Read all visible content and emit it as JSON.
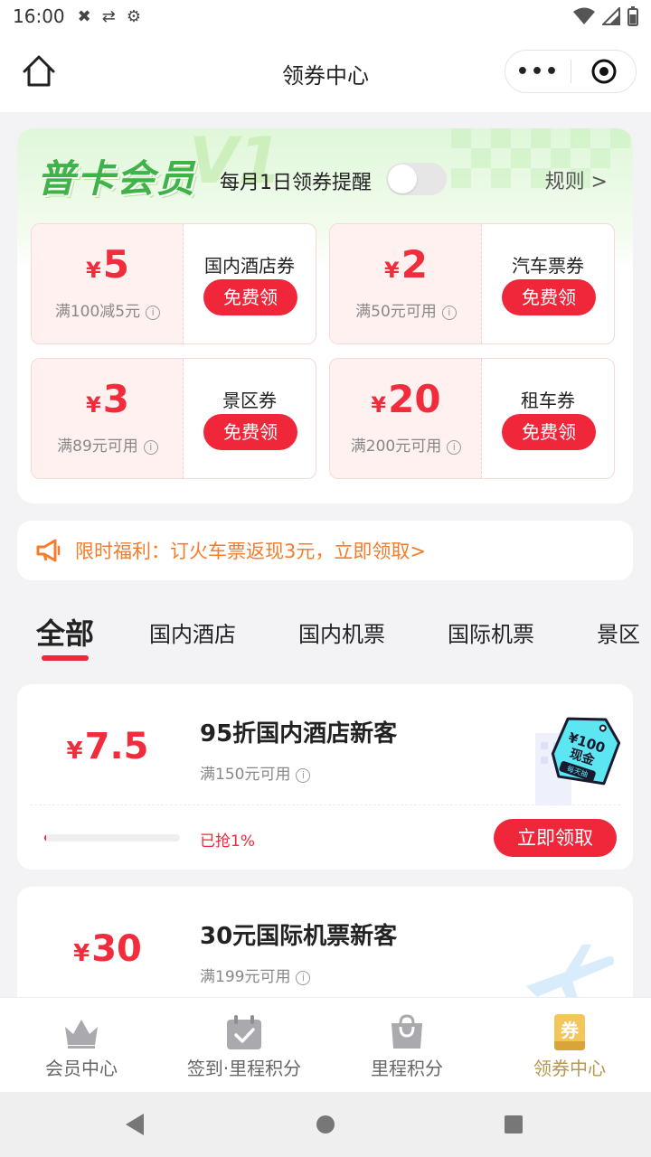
{
  "status_bar": {
    "time": "16:00"
  },
  "nav": {
    "title": "领券中心",
    "capsule_dots": "•••"
  },
  "member": {
    "logo_text": "普卡会员",
    "reminder_label": "每月1日领券提醒",
    "reminder_on": false,
    "rules_label": "规则 >"
  },
  "coupons": [
    {
      "currency": "¥",
      "amount": "5",
      "condition": "满100减5元",
      "name": "国内酒店券",
      "button": "免费领"
    },
    {
      "currency": "¥",
      "amount": "2",
      "condition": "满50元可用",
      "name": "汽车票券",
      "button": "免费领"
    },
    {
      "currency": "¥",
      "amount": "3",
      "condition": "满89元可用",
      "name": "景区券",
      "button": "免费领"
    },
    {
      "currency": "¥",
      "amount": "20",
      "condition": "满200元可用",
      "name": "租车券",
      "button": "免费领"
    }
  ],
  "promo": {
    "text": "限时福利：订火车票返现3元，立即领取>"
  },
  "tabs": [
    "全部",
    "国内酒店",
    "国内机票",
    "国际机票",
    "景区"
  ],
  "list": [
    {
      "currency": "¥",
      "amount": "7.5",
      "title": "95折国内酒店新客",
      "condition": "满150元可用",
      "progress_label": "已抢1%",
      "progress": 0.01,
      "button": "立即领取",
      "badge_amount": "¥100",
      "badge_text": "现金",
      "badge_sub": "每天抽"
    },
    {
      "currency": "¥",
      "amount": "30",
      "title": "30元国际机票新客",
      "condition": "满199元可用"
    }
  ],
  "bottom_nav": [
    {
      "label": "会员中心",
      "icon": "crown-icon",
      "active": false
    },
    {
      "label": "签到·里程积分",
      "icon": "calendar-check-icon",
      "active": false
    },
    {
      "label": "里程积分",
      "icon": "shopping-bag-icon",
      "active": false
    },
    {
      "label": "领券中心",
      "icon": "coupon-icon",
      "active": true,
      "icon_text": "券"
    }
  ],
  "colors": {
    "accent": "#f0273a",
    "member_green": "#3fb24a",
    "promo_orange": "#f47c2a",
    "nav_active": "#b89650"
  }
}
